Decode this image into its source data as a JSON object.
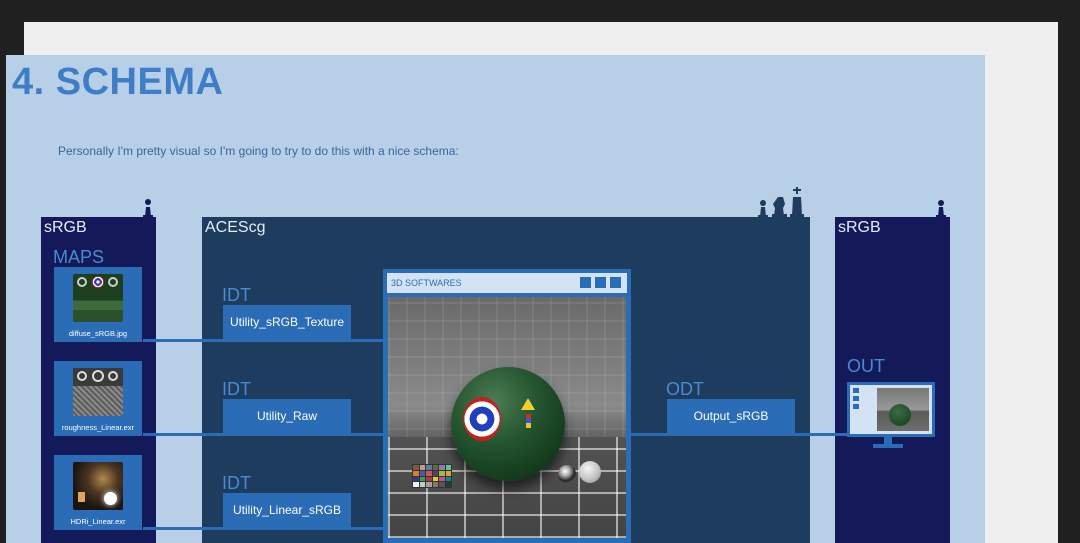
{
  "slide": {
    "title": "4. SCHEMA",
    "intro": "Personally I'm pretty visual so I'm going to try to do this with a nice schema:"
  },
  "left_column": {
    "label": "sRGB",
    "section_label": "MAPS",
    "maps": [
      {
        "caption": "diffuse_sRGB.jpg"
      },
      {
        "caption": "roughness_Linear.exr"
      },
      {
        "caption": "HDRi_Linear.exr"
      }
    ]
  },
  "middle_column": {
    "label": "ACEScg",
    "transforms": [
      {
        "stage": "IDT",
        "name": "Utility_sRGB_Texture"
      },
      {
        "stage": "IDT",
        "name": "Utility_Raw"
      },
      {
        "stage": "IDT",
        "name": "Utility_Linear_sRGB"
      }
    ],
    "software_window": {
      "title": "3D SOFTWARES"
    },
    "output": {
      "stage": "ODT",
      "name": "Output_sRGB"
    }
  },
  "right_column": {
    "label": "sRGB",
    "section_label": "OUT"
  },
  "colors": {
    "page_bg": "#b8cfe8",
    "srgb_column": "#141a59",
    "aces_column": "#1d3c5e",
    "node": "#2b6cb6",
    "title": "#3f7ec4"
  },
  "icons": [
    "chess-pawn-icon",
    "chess-knight-icon",
    "chess-king-icon",
    "monitor-icon"
  ]
}
